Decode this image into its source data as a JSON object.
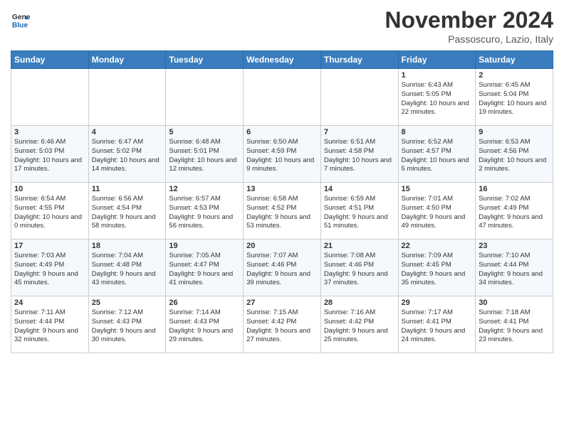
{
  "header": {
    "logo_line1": "General",
    "logo_line2": "Blue",
    "month": "November 2024",
    "location": "Passoscuro, Lazio, Italy"
  },
  "weekdays": [
    "Sunday",
    "Monday",
    "Tuesday",
    "Wednesday",
    "Thursday",
    "Friday",
    "Saturday"
  ],
  "weeks": [
    [
      {
        "day": "",
        "sunrise": "",
        "sunset": "",
        "daylight": ""
      },
      {
        "day": "",
        "sunrise": "",
        "sunset": "",
        "daylight": ""
      },
      {
        "day": "",
        "sunrise": "",
        "sunset": "",
        "daylight": ""
      },
      {
        "day": "",
        "sunrise": "",
        "sunset": "",
        "daylight": ""
      },
      {
        "day": "",
        "sunrise": "",
        "sunset": "",
        "daylight": ""
      },
      {
        "day": "1",
        "sunrise": "Sunrise: 6:43 AM",
        "sunset": "Sunset: 5:05 PM",
        "daylight": "Daylight: 10 hours and 22 minutes."
      },
      {
        "day": "2",
        "sunrise": "Sunrise: 6:45 AM",
        "sunset": "Sunset: 5:04 PM",
        "daylight": "Daylight: 10 hours and 19 minutes."
      }
    ],
    [
      {
        "day": "3",
        "sunrise": "Sunrise: 6:46 AM",
        "sunset": "Sunset: 5:03 PM",
        "daylight": "Daylight: 10 hours and 17 minutes."
      },
      {
        "day": "4",
        "sunrise": "Sunrise: 6:47 AM",
        "sunset": "Sunset: 5:02 PM",
        "daylight": "Daylight: 10 hours and 14 minutes."
      },
      {
        "day": "5",
        "sunrise": "Sunrise: 6:48 AM",
        "sunset": "Sunset: 5:01 PM",
        "daylight": "Daylight: 10 hours and 12 minutes."
      },
      {
        "day": "6",
        "sunrise": "Sunrise: 6:50 AM",
        "sunset": "Sunset: 4:59 PM",
        "daylight": "Daylight: 10 hours and 9 minutes."
      },
      {
        "day": "7",
        "sunrise": "Sunrise: 6:51 AM",
        "sunset": "Sunset: 4:58 PM",
        "daylight": "Daylight: 10 hours and 7 minutes."
      },
      {
        "day": "8",
        "sunrise": "Sunrise: 6:52 AM",
        "sunset": "Sunset: 4:57 PM",
        "daylight": "Daylight: 10 hours and 5 minutes."
      },
      {
        "day": "9",
        "sunrise": "Sunrise: 6:53 AM",
        "sunset": "Sunset: 4:56 PM",
        "daylight": "Daylight: 10 hours and 2 minutes."
      }
    ],
    [
      {
        "day": "10",
        "sunrise": "Sunrise: 6:54 AM",
        "sunset": "Sunset: 4:55 PM",
        "daylight": "Daylight: 10 hours and 0 minutes."
      },
      {
        "day": "11",
        "sunrise": "Sunrise: 6:56 AM",
        "sunset": "Sunset: 4:54 PM",
        "daylight": "Daylight: 9 hours and 58 minutes."
      },
      {
        "day": "12",
        "sunrise": "Sunrise: 6:57 AM",
        "sunset": "Sunset: 4:53 PM",
        "daylight": "Daylight: 9 hours and 56 minutes."
      },
      {
        "day": "13",
        "sunrise": "Sunrise: 6:58 AM",
        "sunset": "Sunset: 4:52 PM",
        "daylight": "Daylight: 9 hours and 53 minutes."
      },
      {
        "day": "14",
        "sunrise": "Sunrise: 6:59 AM",
        "sunset": "Sunset: 4:51 PM",
        "daylight": "Daylight: 9 hours and 51 minutes."
      },
      {
        "day": "15",
        "sunrise": "Sunrise: 7:01 AM",
        "sunset": "Sunset: 4:50 PM",
        "daylight": "Daylight: 9 hours and 49 minutes."
      },
      {
        "day": "16",
        "sunrise": "Sunrise: 7:02 AM",
        "sunset": "Sunset: 4:49 PM",
        "daylight": "Daylight: 9 hours and 47 minutes."
      }
    ],
    [
      {
        "day": "17",
        "sunrise": "Sunrise: 7:03 AM",
        "sunset": "Sunset: 4:49 PM",
        "daylight": "Daylight: 9 hours and 45 minutes."
      },
      {
        "day": "18",
        "sunrise": "Sunrise: 7:04 AM",
        "sunset": "Sunset: 4:48 PM",
        "daylight": "Daylight: 9 hours and 43 minutes."
      },
      {
        "day": "19",
        "sunrise": "Sunrise: 7:05 AM",
        "sunset": "Sunset: 4:47 PM",
        "daylight": "Daylight: 9 hours and 41 minutes."
      },
      {
        "day": "20",
        "sunrise": "Sunrise: 7:07 AM",
        "sunset": "Sunset: 4:46 PM",
        "daylight": "Daylight: 9 hours and 39 minutes."
      },
      {
        "day": "21",
        "sunrise": "Sunrise: 7:08 AM",
        "sunset": "Sunset: 4:46 PM",
        "daylight": "Daylight: 9 hours and 37 minutes."
      },
      {
        "day": "22",
        "sunrise": "Sunrise: 7:09 AM",
        "sunset": "Sunset: 4:45 PM",
        "daylight": "Daylight: 9 hours and 35 minutes."
      },
      {
        "day": "23",
        "sunrise": "Sunrise: 7:10 AM",
        "sunset": "Sunset: 4:44 PM",
        "daylight": "Daylight: 9 hours and 34 minutes."
      }
    ],
    [
      {
        "day": "24",
        "sunrise": "Sunrise: 7:11 AM",
        "sunset": "Sunset: 4:44 PM",
        "daylight": "Daylight: 9 hours and 32 minutes."
      },
      {
        "day": "25",
        "sunrise": "Sunrise: 7:12 AM",
        "sunset": "Sunset: 4:43 PM",
        "daylight": "Daylight: 9 hours and 30 minutes."
      },
      {
        "day": "26",
        "sunrise": "Sunrise: 7:14 AM",
        "sunset": "Sunset: 4:43 PM",
        "daylight": "Daylight: 9 hours and 29 minutes."
      },
      {
        "day": "27",
        "sunrise": "Sunrise: 7:15 AM",
        "sunset": "Sunset: 4:42 PM",
        "daylight": "Daylight: 9 hours and 27 minutes."
      },
      {
        "day": "28",
        "sunrise": "Sunrise: 7:16 AM",
        "sunset": "Sunset: 4:42 PM",
        "daylight": "Daylight: 9 hours and 25 minutes."
      },
      {
        "day": "29",
        "sunrise": "Sunrise: 7:17 AM",
        "sunset": "Sunset: 4:41 PM",
        "daylight": "Daylight: 9 hours and 24 minutes."
      },
      {
        "day": "30",
        "sunrise": "Sunrise: 7:18 AM",
        "sunset": "Sunset: 4:41 PM",
        "daylight": "Daylight: 9 hours and 23 minutes."
      }
    ]
  ]
}
